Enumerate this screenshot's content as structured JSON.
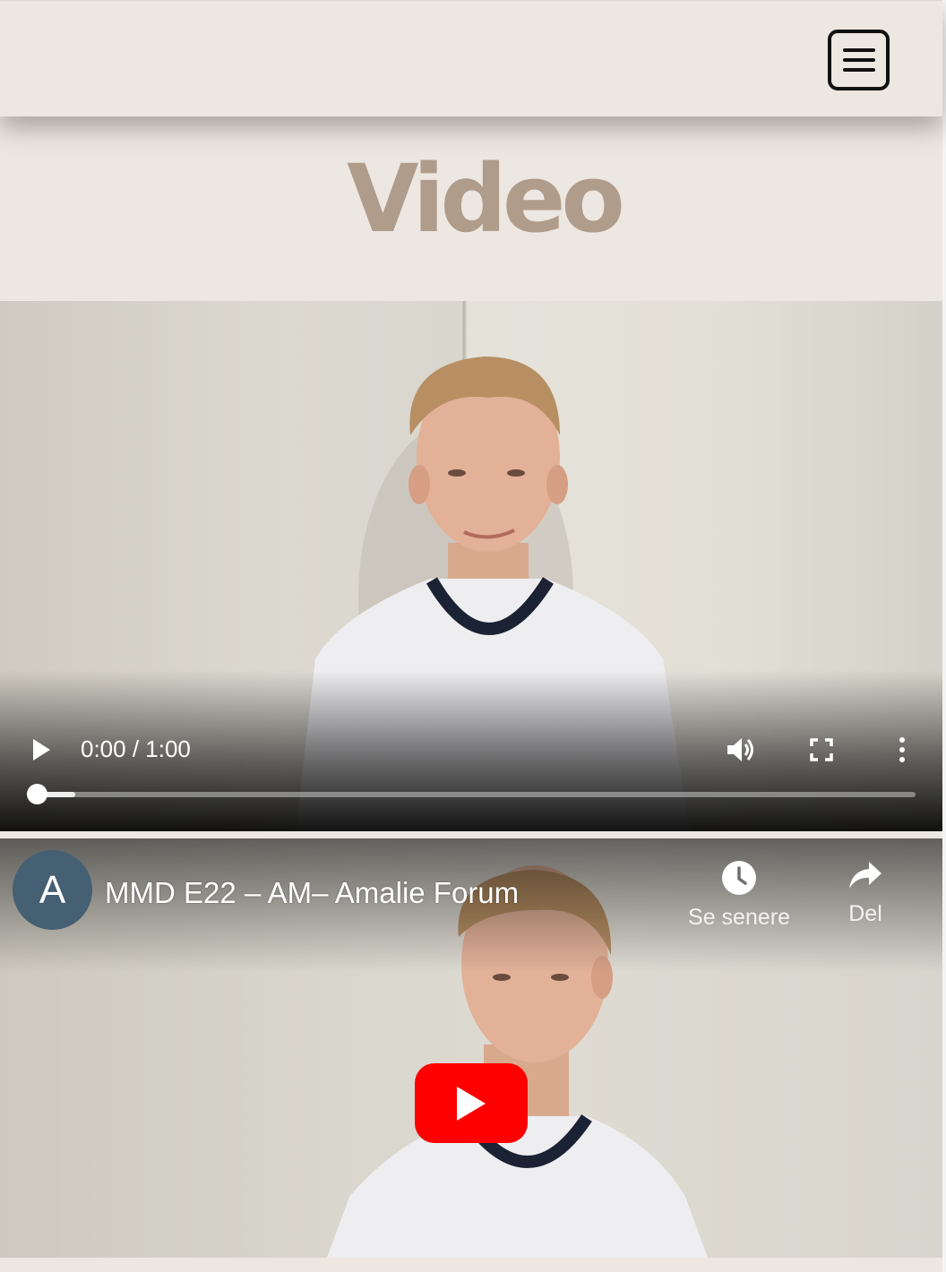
{
  "header": {
    "menu_icon": "hamburger-menu-icon"
  },
  "page": {
    "title": "Video"
  },
  "video_player": {
    "time_display": "0:00 / 1:00",
    "progress_fraction": 0.0,
    "icons": [
      "play-icon",
      "volume-icon",
      "fullscreen-icon",
      "more-options-icon"
    ]
  },
  "youtube_embed": {
    "channel_initial": "A",
    "title": "MMD E22 – AM– Amalie Forum",
    "watch_later_label": "Se senere",
    "share_label": "Del",
    "accent_color": "#ff0000",
    "avatar_color": "#455f73"
  },
  "colors": {
    "background": "#ede7e1",
    "title_color": "#b09c8b"
  }
}
